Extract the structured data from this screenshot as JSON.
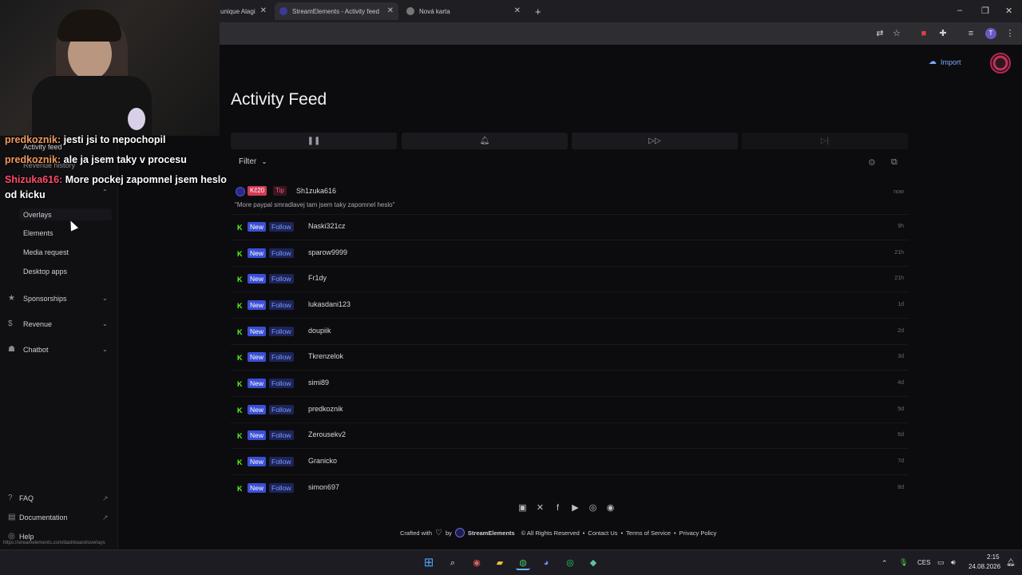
{
  "browser": {
    "tabs": [
      {
        "label": "unique Alagi"
      },
      {
        "label": "StreamElements - Activity feed"
      },
      {
        "label": "Nová karta"
      }
    ],
    "new_tab_glyph": "+",
    "window_controls": [
      "minimize-icon",
      "restore-icon",
      "close-icon"
    ]
  },
  "header": {
    "import_label": "Import"
  },
  "page": {
    "title": "Activity Feed",
    "filter_label": "Filter",
    "controls": [
      "pause-icon",
      "bell-icon",
      "skip-icon",
      "skip-end-icon"
    ]
  },
  "sidebar": {
    "partial_items": [
      "Activity feed",
      "Revenue history"
    ],
    "sub_items": [
      {
        "label": "Overlays"
      },
      {
        "label": "Elements"
      },
      {
        "label": "Media request"
      },
      {
        "label": "Desktop apps"
      }
    ],
    "sections": [
      {
        "label": "Sponsorships",
        "icon": "star-icon"
      },
      {
        "label": "Revenue",
        "icon": "dollar-icon"
      },
      {
        "label": "Chatbot",
        "icon": "bot-icon"
      }
    ],
    "bottom": [
      {
        "label": "FAQ"
      },
      {
        "label": "Documentation"
      },
      {
        "label": "Help"
      }
    ],
    "status_url": "https://streamelements.com/dashboard/overlays"
  },
  "chat": [
    {
      "user": "predkoznik:",
      "text": "jesti jsi to nepochopil"
    },
    {
      "user": "predkoznik:",
      "text": "ale ja jsem taky v procesu"
    },
    {
      "user": "Shizuka616:",
      "text": "More pockej zapomnel jsem heslo od kicku"
    }
  ],
  "tip": {
    "amount": "Kč20",
    "label": "Tip",
    "name": "Sh1zuka616",
    "message": "\"More paypal smradlavej tam jsem taky zapomnel heslo\"",
    "time": "now"
  },
  "feed": {
    "new_label": "New",
    "follow_label": "Follow",
    "platform_glyph": "K",
    "rows": [
      {
        "name": "Naski321cz",
        "time": "9h"
      },
      {
        "name": "sparow9999",
        "time": "21h"
      },
      {
        "name": "Fr1dy",
        "time": "21h"
      },
      {
        "name": "lukasdani123",
        "time": "1d"
      },
      {
        "name": "doupiik",
        "time": "2d"
      },
      {
        "name": "Tkrenzelok",
        "time": "3d"
      },
      {
        "name": "simi89",
        "time": "4d"
      },
      {
        "name": "predkoznik",
        "time": "5d"
      },
      {
        "name": "Zerousekv2",
        "time": "6d"
      },
      {
        "name": "Granicko",
        "time": "7d"
      },
      {
        "name": "simon697",
        "time": "8d"
      }
    ]
  },
  "footer": {
    "crafted": "Crafted with",
    "by": "by",
    "brand": "StreamElements",
    "rights": "© All Rights Reserved",
    "contact": "Contact Us",
    "terms": "Terms of Service",
    "privacy": "Privacy Policy",
    "socials": [
      "twitch-icon",
      "x-icon",
      "facebook-icon",
      "youtube-icon",
      "instagram-icon",
      "discord-icon"
    ]
  },
  "taskbar": {
    "lang": "CES",
    "time": "2:15",
    "date": "24.08.2026"
  },
  "colors": {
    "kick_green": "#53fc18",
    "new_badge": "#3b4fd6",
    "follow_text": "#7d97ff",
    "tip_red": "#d23a55",
    "accent_blue": "#7fa8ff"
  }
}
